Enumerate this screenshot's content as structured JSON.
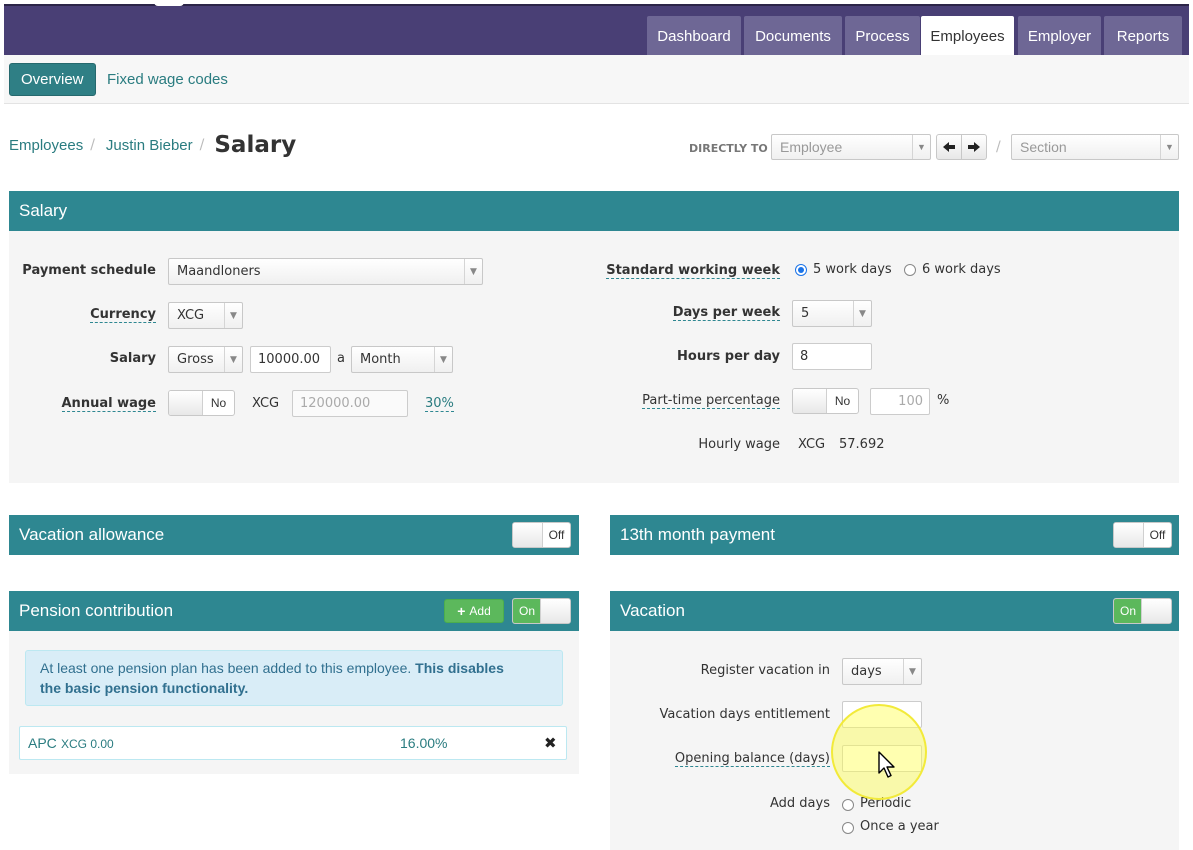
{
  "nav": {
    "tabs": [
      {
        "label": "Dashboard"
      },
      {
        "label": "Documents"
      },
      {
        "label": "Process"
      },
      {
        "label": "Employees"
      },
      {
        "label": "Employer"
      },
      {
        "label": "Reports"
      }
    ],
    "active_tab": "Employees"
  },
  "subnav": {
    "overview": "Overview",
    "fixed_wage_codes": "Fixed wage codes"
  },
  "breadcrumb": {
    "employees": "Employees",
    "sep": "/",
    "person": "Justin Bieber",
    "current": "Salary"
  },
  "directly_to": {
    "label": "DIRECTLY TO",
    "employee_placeholder": "Employee",
    "section_placeholder": "Section",
    "sep": "/"
  },
  "salary": {
    "title": "Salary",
    "payment_schedule_label": "Payment schedule",
    "payment_schedule_value": "Maandloners",
    "currency_label": "Currency",
    "currency_value": "XCG",
    "salary_label": "Salary",
    "salary_type": "Gross",
    "salary_amount": "10000.00",
    "salary_per": "a",
    "salary_period": "Month",
    "annual_wage_label": "Annual wage",
    "annual_wage_toggle": "No",
    "annual_currency": "XCG",
    "annual_amount": "120000.00",
    "annual_percent": "30%",
    "standard_week_label": "Standard working week",
    "week_option_5": "5 work days",
    "week_option_6": "6 work days",
    "days_per_week_label": "Days per week",
    "days_per_week_value": "5",
    "hours_per_day_label": "Hours per day",
    "hours_per_day_value": "8",
    "part_time_label": "Part-time percentage",
    "part_time_toggle": "No",
    "part_time_value": "100",
    "part_time_unit": "%",
    "hourly_wage_label": "Hourly wage",
    "hourly_wage_currency": "XCG",
    "hourly_wage_value": "57.692"
  },
  "vacation_allowance": {
    "title": "Vacation allowance",
    "toggle": "Off"
  },
  "thirteenth_month": {
    "title": "13th month payment",
    "toggle": "Off"
  },
  "pension": {
    "title": "Pension contribution",
    "add_label": "Add",
    "toggle": "On",
    "notice_normal": "At least one pension plan has been added to this employee.",
    "notice_bold_1": "This disables",
    "notice_bold_2": "the basic pension functionality.",
    "plan_name": "APC",
    "plan_amount": "XCG 0.00",
    "plan_percent": "16.00%"
  },
  "vacation": {
    "title": "Vacation",
    "toggle": "On",
    "register_label": "Register vacation in",
    "register_value": "days",
    "entitlement_label": "Vacation days entitlement",
    "entitlement_value": "",
    "opening_label": "Opening balance (days)",
    "opening_value": "",
    "add_days_label": "Add days",
    "option_periodic": "Periodic",
    "option_yearly": "Once a year"
  },
  "colors": {
    "topbar": "#493f75",
    "tab": "#6e6795",
    "panel_header": "#2e8791",
    "link": "#2a7c80",
    "toggle_on": "#5cb85c",
    "highlight": "#ffff66"
  }
}
